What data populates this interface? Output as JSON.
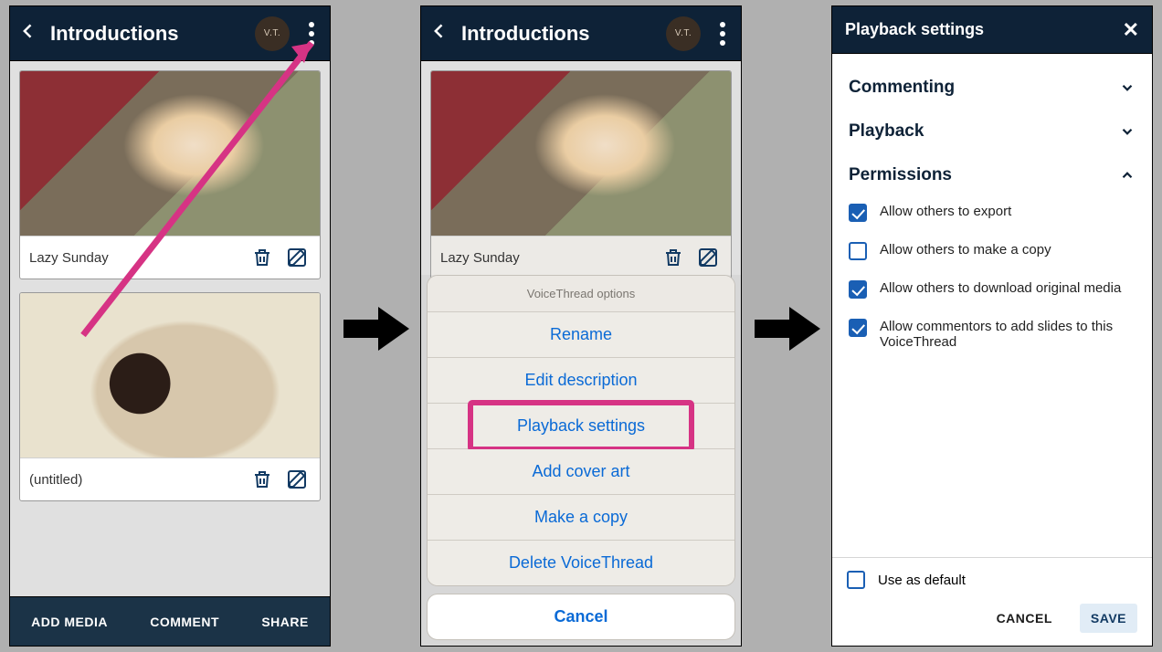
{
  "screen1": {
    "title": "Introductions",
    "cards": [
      {
        "caption": "Lazy Sunday"
      },
      {
        "caption": "(untitled)"
      }
    ],
    "bottom": {
      "add_media": "ADD MEDIA",
      "comment": "COMMENT",
      "share": "SHARE"
    }
  },
  "screen2": {
    "title": "Introductions",
    "card_caption": "Lazy Sunday",
    "sheet_title": "VoiceThread options",
    "options": {
      "rename": "Rename",
      "edit_desc": "Edit description",
      "playback": "Playback settings",
      "cover": "Add cover art",
      "copy": "Make a copy",
      "delete": "Delete VoiceThread"
    },
    "cancel": "Cancel"
  },
  "screen3": {
    "title": "Playback settings",
    "sections": {
      "commenting": "Commenting",
      "playback": "Playback",
      "permissions": "Permissions"
    },
    "perms": {
      "export": {
        "label": "Allow others to export",
        "checked": true
      },
      "copy": {
        "label": "Allow others to make a copy",
        "checked": false
      },
      "download": {
        "label": "Allow others to download original media",
        "checked": true
      },
      "slides": {
        "label": "Allow commentors to add slides to this VoiceThread",
        "checked": true
      }
    },
    "use_default": {
      "label": "Use as default",
      "checked": false
    },
    "buttons": {
      "cancel": "CANCEL",
      "save": "SAVE"
    }
  }
}
